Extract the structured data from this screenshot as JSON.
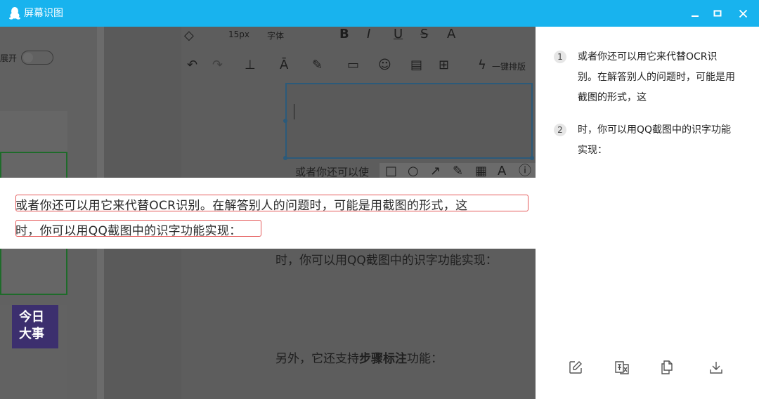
{
  "window": {
    "title": "屏幕识图",
    "minimize_label": "_",
    "close_label": "✕"
  },
  "editor_toolbar": {
    "font_size": "15px",
    "font_family": "字体",
    "row1_items": [
      "B",
      "I",
      "U",
      "S",
      "A"
    ],
    "one_key_layout": "一键排版",
    "expand_label": "展开"
  },
  "preview": {
    "doc_line_partial": "或者你还可以使",
    "selected_lines": [
      "或者你还可以用它来代替OCR识别。在解答别人的问题时，可能是用截图的形式，这",
      "时，你可以用QQ截图中的识字功能实现："
    ],
    "doc_line_1": "时，你可以用QQ截图中的识字功能实现：",
    "doc_line_2_prefix": "另外，它还支持",
    "doc_line_2_bold": "步骤标注",
    "doc_line_2_suffix": "功能：",
    "news_badge": [
      "今日",
      "大事"
    ]
  },
  "results": [
    {
      "num": "1",
      "text": "或者你还可以用它来代替OCR识别。在解答别人的问题时，可能是用截图的形式，这"
    },
    {
      "num": "2",
      "text": "时，你可以用QQ截图中的识字功能实现："
    }
  ],
  "actions": [
    "edit-icon",
    "translate-icon",
    "copy-icon",
    "download-icon"
  ],
  "colors": {
    "titlebar": "#18b3ee",
    "highlight_border": "#e45a5a",
    "overlay": "#595959"
  }
}
